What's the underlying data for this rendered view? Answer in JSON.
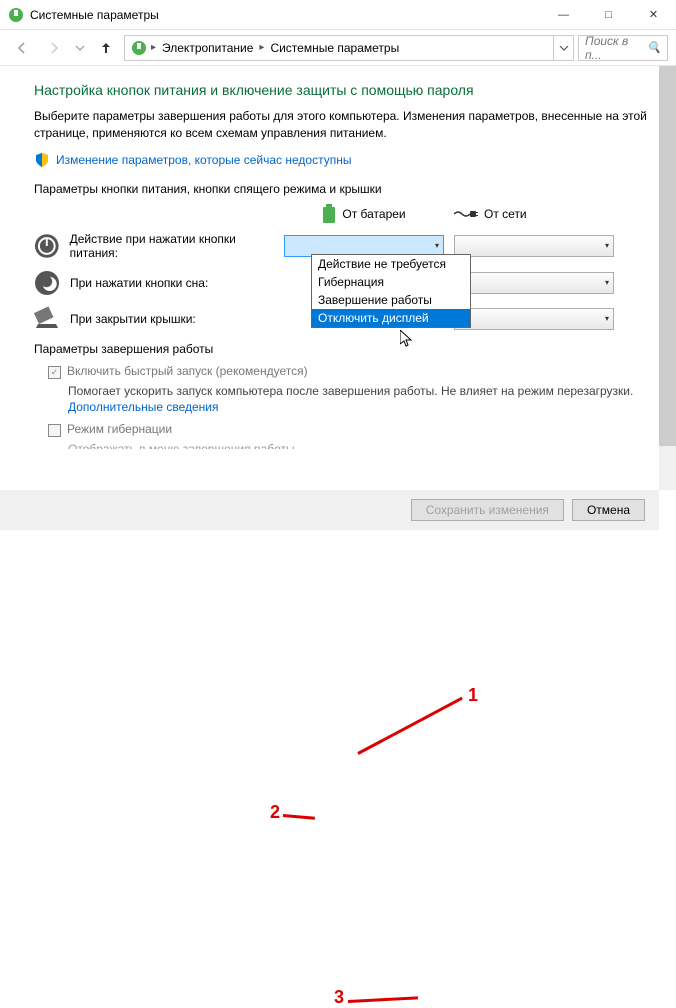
{
  "window": {
    "title": "Системные параметры"
  },
  "nav": {
    "breadcrumb": [
      "Электропитание",
      "Системные параметры"
    ],
    "search_placeholder": "Поиск в п..."
  },
  "page": {
    "heading": "Настройка кнопок питания и включение защиты с помощью пароля",
    "description": "Выберите параметры завершения работы для этого компьютера. Изменения параметров, внесенные на этой странице, применяются ко всем схемам управления питанием.",
    "change_unavailable_link": "Изменение параметров, которые сейчас недоступны"
  },
  "power_buttons": {
    "section_title": "Параметры кнопки питания, кнопки спящего режима и крышки",
    "col_battery": "От батареи",
    "col_ac": "От сети",
    "rows": [
      {
        "label": "Действие при нажатии кнопки питания:"
      },
      {
        "label": "При нажатии кнопки сна:"
      },
      {
        "label": "При закрытии крышки:"
      }
    ],
    "dropdown_options": [
      "Действие не требуется",
      "Гибернация",
      "Завершение работы",
      "Отключить дисплей"
    ],
    "dropdown_selected_index": 3
  },
  "shutdown": {
    "section_title": "Параметры завершения работы",
    "fast_startup": {
      "label": "Включить быстрый запуск (рекомендуется)",
      "checked": true,
      "desc": "Помогает ускорить запуск компьютера после завершения работы. Не влияет на режим перезагрузки. ",
      "link": "Дополнительные сведения"
    },
    "hibernation": {
      "label": "Режим гибернации",
      "checked": false,
      "desc_partial": "Отображать в меню завершения работы"
    }
  },
  "footer": {
    "save": "Сохранить изменения",
    "cancel": "Отмена"
  },
  "annotations": {
    "n1": "1",
    "n2": "2",
    "n3": "3"
  }
}
